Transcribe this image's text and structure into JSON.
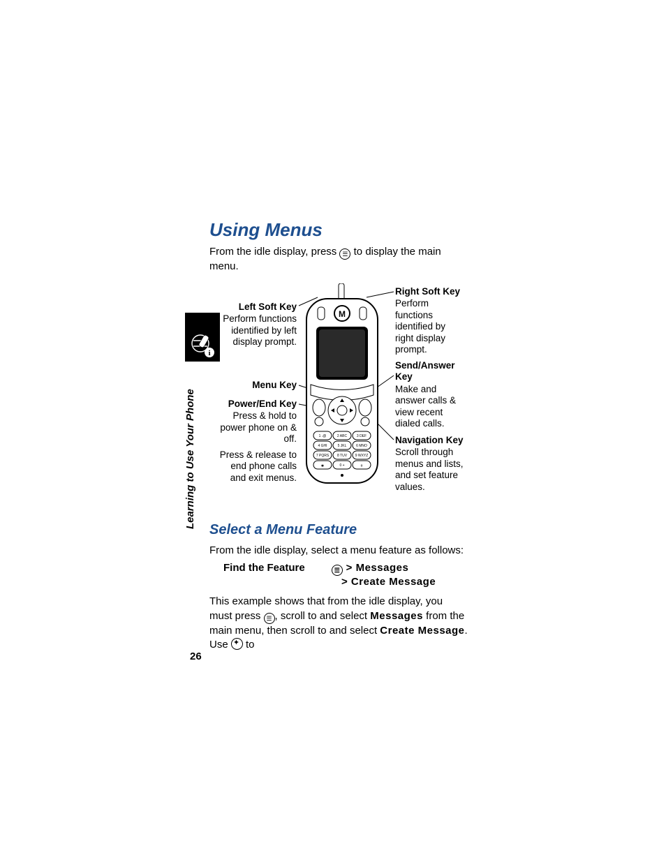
{
  "page_number": "26",
  "side_label": "Learning to Use Your Phone",
  "title": "Using Menus",
  "intro_a": "From the idle display, press ",
  "intro_b": " to display the main menu.",
  "subtitle": "Select a Menu Feature",
  "select_intro": "From the idle display, select a menu feature as follows:",
  "feature_label": "Find the Feature",
  "feature_step1": "> Messages",
  "feature_step2": "> Create Message",
  "para2_a": "This example shows that from the idle display, you must press ",
  "para2_b": ", scroll to and select ",
  "para2_msg": "Messages",
  "para2_c": " from the main menu, then scroll to and select ",
  "para2_create": "Create Message",
  "para2_d": ". Use ",
  "para2_e": " to",
  "callouts": {
    "left_soft": {
      "h": "Left Soft Key",
      "t": "Perform functions identified by left display prompt."
    },
    "menu_key": {
      "h": "Menu Key"
    },
    "power_end": {
      "h": "Power/End Key",
      "t1": "Press & hold to power phone on & off.",
      "t2": "Press & release to end phone calls and exit menus."
    },
    "right_soft": {
      "h": "Right Soft Key",
      "t": "Perform functions identified by right display prompt."
    },
    "send_ans": {
      "h": "Send/Answer Key",
      "t": "Make and answer calls & view recent dialed calls."
    },
    "nav_key": {
      "h": "Navigation Key",
      "t": "Scroll through menus and lists, and set feature values."
    }
  },
  "keypad": {
    "1": "1 .@",
    "2": "2 ABC",
    "3": "3 DEF",
    "4": "4 GHI",
    "5": "5 0 JKL",
    "6": "6 MNO",
    "7": "7 PQRS",
    "8": "8 TUV",
    "9": "9 WXYZ",
    "star": "*",
    "0": "0 +",
    "hash": "#"
  }
}
